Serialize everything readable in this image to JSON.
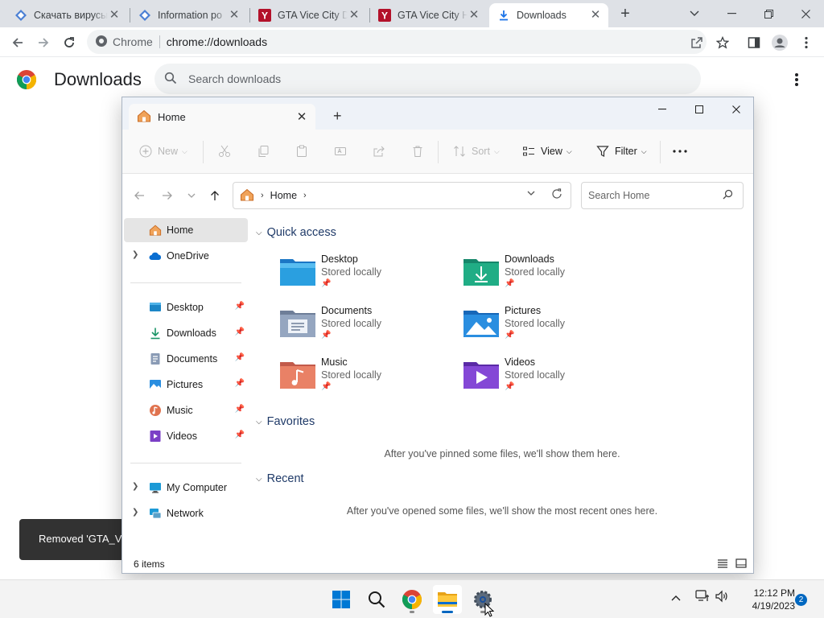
{
  "browser": {
    "tabs": [
      {
        "title": "Скачать вирусы",
        "icon": "diamond-favicon",
        "active": false
      },
      {
        "title": "Information po",
        "icon": "diamond-favicon",
        "active": false
      },
      {
        "title": "GTA Vice City D",
        "icon": "y-favicon",
        "active": false
      },
      {
        "title": "GTA Vice City H",
        "icon": "y-favicon",
        "active": false
      },
      {
        "title": "Downloads",
        "icon": "download-icon",
        "active": true
      }
    ],
    "site_label": "Chrome",
    "url": "chrome://downloads"
  },
  "downloads_page": {
    "title": "Downloads",
    "search_placeholder": "Search downloads",
    "toast_text": "Removed 'GTA_Vi"
  },
  "explorer": {
    "tab_title": "Home",
    "commands": {
      "new": "New",
      "sort": "Sort",
      "view": "View",
      "filter": "Filter"
    },
    "address": {
      "location": "Home"
    },
    "search_placeholder": "Search Home",
    "nav": {
      "home": "Home",
      "onedrive": "OneDrive",
      "pinned": [
        "Desktop",
        "Downloads",
        "Documents",
        "Pictures",
        "Music",
        "Videos"
      ],
      "my_computer": "My Computer",
      "network": "Network"
    },
    "sections": {
      "quick_access": "Quick access",
      "favorites": "Favorites",
      "recent": "Recent"
    },
    "quick_access": [
      {
        "name": "Desktop",
        "status": "Stored locally",
        "icon": "desktop-folder-icon"
      },
      {
        "name": "Downloads",
        "status": "Stored locally",
        "icon": "downloads-folder-icon"
      },
      {
        "name": "Documents",
        "status": "Stored locally",
        "icon": "documents-folder-icon"
      },
      {
        "name": "Pictures",
        "status": "Stored locally",
        "icon": "pictures-folder-icon"
      },
      {
        "name": "Music",
        "status": "Stored locally",
        "icon": "music-folder-icon"
      },
      {
        "name": "Videos",
        "status": "Stored locally",
        "icon": "videos-folder-icon"
      }
    ],
    "favorites_empty": "After you've pinned some files, we'll show them here.",
    "recent_empty": "After you've opened some files, we'll show the most recent ones here.",
    "status_count": "6 items"
  },
  "taskbar": {
    "time": "12:12 PM",
    "date": "4/19/2023",
    "notification_count": "2"
  },
  "colors": {
    "accent": "#0067c0",
    "chrome_frame": "#dee1e6",
    "section_header": "#1f3a68"
  }
}
